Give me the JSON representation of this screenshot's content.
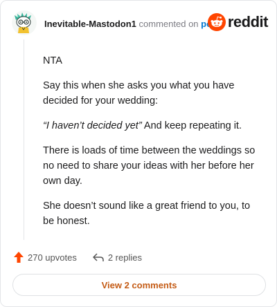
{
  "header": {
    "username": "Inevitable-Mastodon1",
    "commented_text": "commented on",
    "post_link": "post",
    "brand": "reddit"
  },
  "comment": {
    "paragraphs": [
      "NTA",
      "Say this when she asks you what you have decided for your wedding:",
      "And keep repeating it.",
      "There is loads of time between the weddings so no need to share your ideas with her before her own day.",
      "She doesn’t sound like a great friend to you, to be honest."
    ],
    "quote": "“I haven’t decided yet”"
  },
  "actions": {
    "upvotes": "270 upvotes",
    "replies": "2 replies"
  },
  "footer": {
    "view_comments": "View 2 comments"
  },
  "colors": {
    "brand_orange": "#ff4500",
    "link_blue": "#0079d3",
    "view_button_text": "#c45b15"
  },
  "icons": [
    "avatar-snoo",
    "reddit-logo-icon",
    "upvote-arrow-icon",
    "reply-arrow-icon"
  ]
}
